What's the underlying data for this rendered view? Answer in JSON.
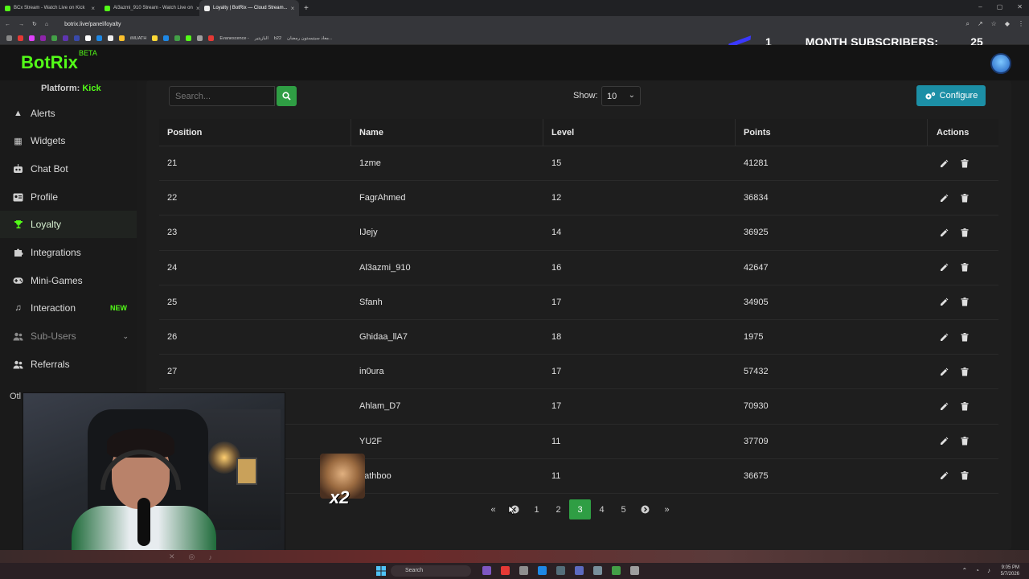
{
  "browser": {
    "tabs": [
      {
        "label": "BCx Stream - Watch Live on Kick",
        "color": "#53fc18",
        "active": false
      },
      {
        "label": "Al3azmi_910 Stream - Watch Live on",
        "color": "#53fc18",
        "active": false
      },
      {
        "label": "Loyalty | BotRix — Cloud Stream...",
        "color": "#ffffff",
        "active": true
      }
    ],
    "url": "botrix.live/panel/loyalty",
    "bookmarks": [
      "iMUATH",
      "Evanescence -",
      "البازيتير",
      "b22",
      "معاذ سيتيستون رمضان..."
    ]
  },
  "stream_overlay": {
    "left_number": "1",
    "text": "MONTH SUBSCRIBERS:",
    "count": "25"
  },
  "header": {
    "logo": "BotRix",
    "beta": "BETA"
  },
  "sidebar": {
    "platform_label": "Platform:",
    "platform_value": "Kick",
    "items": [
      {
        "label": "Alerts",
        "icon": "warning-icon"
      },
      {
        "label": "Widgets",
        "icon": "grid-icon"
      },
      {
        "label": "Chat Bot",
        "icon": "bot-icon"
      },
      {
        "label": "Profile",
        "icon": "profile-card-icon"
      },
      {
        "label": "Loyalty",
        "icon": "trophy-icon"
      },
      {
        "label": "Integrations",
        "icon": "puzzle-icon"
      },
      {
        "label": "Mini-Games",
        "icon": "gamepad-icon"
      },
      {
        "label": "Interaction",
        "icon": "music-note-icon",
        "badge": "NEW"
      },
      {
        "label": "Sub-Users",
        "icon": "users-icon"
      },
      {
        "label": "Referrals",
        "icon": "users-group-icon"
      }
    ],
    "partial_label": "Otl"
  },
  "toolbar": {
    "search_placeholder": "Search...",
    "show_label": "Show:",
    "show_value": "10",
    "configure_label": "Configure"
  },
  "table": {
    "headers": [
      "Position",
      "Name",
      "Level",
      "Points",
      "Actions"
    ],
    "rows": [
      {
        "position": "21",
        "name": "1zme",
        "level": "15",
        "points": "41281"
      },
      {
        "position": "22",
        "name": "FagrAhmed",
        "level": "12",
        "points": "36834"
      },
      {
        "position": "23",
        "name": "IJejy",
        "level": "14",
        "points": "36925"
      },
      {
        "position": "24",
        "name": "Al3azmi_910",
        "level": "16",
        "points": "42647"
      },
      {
        "position": "25",
        "name": "Sfanh",
        "level": "17",
        "points": "34905"
      },
      {
        "position": "26",
        "name": "Ghidaa_llA7",
        "level": "18",
        "points": "1975"
      },
      {
        "position": "27",
        "name": "in0ura",
        "level": "17",
        "points": "57432"
      },
      {
        "position": "",
        "name": "Ahlam_D7",
        "level": "17",
        "points": "70930"
      },
      {
        "position": "",
        "name": "YU2F",
        "level": "11",
        "points": "37709"
      },
      {
        "position": "",
        "name": "uathboo",
        "level": "11",
        "points": "36675"
      }
    ]
  },
  "pagination": {
    "first": "«",
    "prev": "‹",
    "pages": [
      "1",
      "2",
      "3",
      "4",
      "5"
    ],
    "current": "3",
    "next": "›",
    "last": "»"
  },
  "emote": {
    "text": "x2"
  },
  "taskbar": {
    "search": "Search",
    "time": "9:05 PM",
    "date": "5/7/2026"
  },
  "colors": {
    "brand_green": "#53fc18",
    "button_green": "#2f9e44",
    "configure_teal": "#1c8fa6"
  }
}
